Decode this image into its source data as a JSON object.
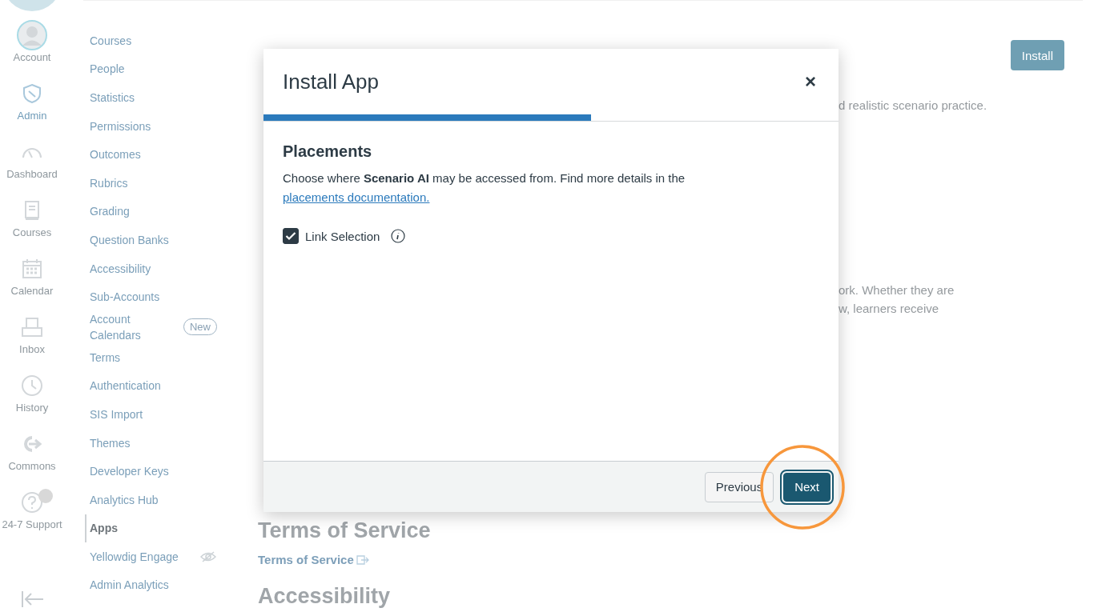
{
  "global_nav": [
    {
      "label": "Account",
      "selected": false,
      "unread": false
    },
    {
      "label": "Admin",
      "selected": true,
      "unread": false
    },
    {
      "label": "Dashboard",
      "selected": false,
      "unread": false
    },
    {
      "label": "Courses",
      "selected": false,
      "unread": false
    },
    {
      "label": "Calendar",
      "selected": false,
      "unread": false
    },
    {
      "label": "Inbox",
      "selected": false,
      "unread": false
    },
    {
      "label": "History",
      "selected": false,
      "unread": false
    },
    {
      "label": "Commons",
      "selected": false,
      "unread": false
    },
    {
      "label": "24-7 Support",
      "selected": false,
      "unread": true
    }
  ],
  "sub_nav": [
    {
      "label": "Courses",
      "selected": false,
      "hidden": false
    },
    {
      "label": "People",
      "selected": false,
      "hidden": false
    },
    {
      "label": "Statistics",
      "selected": false,
      "hidden": false
    },
    {
      "label": "Permissions",
      "selected": false,
      "hidden": false
    },
    {
      "label": "Outcomes",
      "selected": false,
      "hidden": false
    },
    {
      "label": "Rubrics",
      "selected": false,
      "hidden": false
    },
    {
      "label": "Grading",
      "selected": false,
      "hidden": false
    },
    {
      "label": "Question Banks",
      "selected": false,
      "hidden": false
    },
    {
      "label": "Accessibility",
      "selected": false,
      "hidden": false
    },
    {
      "label": "Sub-Accounts",
      "selected": false,
      "hidden": false
    },
    {
      "label": "Account Calendars",
      "selected": false,
      "hidden": false,
      "badge": "New"
    },
    {
      "label": "Terms",
      "selected": false,
      "hidden": false
    },
    {
      "label": "Authentication",
      "selected": false,
      "hidden": false
    },
    {
      "label": "SIS Import",
      "selected": false,
      "hidden": false
    },
    {
      "label": "Themes",
      "selected": false,
      "hidden": false
    },
    {
      "label": "Developer Keys",
      "selected": false,
      "hidden": false
    },
    {
      "label": "Analytics Hub",
      "selected": false,
      "hidden": false
    },
    {
      "label": "Apps",
      "selected": true,
      "hidden": false
    },
    {
      "label": "Yellowdig Engage",
      "selected": false,
      "hidden": true
    },
    {
      "label": "Admin Analytics",
      "selected": false,
      "hidden": false
    }
  ],
  "main": {
    "install_button": "Install",
    "fragments": [
      "d realistic scenario practice.",
      "ork. Whether they are",
      "w, learners receive"
    ],
    "terms_heading": "Terms of Service",
    "terms_link": "Terms of Service",
    "accessibility_heading": "Accessibility"
  },
  "modal": {
    "title": "Install App",
    "close": "×",
    "progress": {
      "level": 0.57
    },
    "heading": "Placements",
    "description": "Choose where **Scenario AI** may be accessed from. Find more details in the",
    "link": "placements documentation.",
    "placements": [
      {
        "label": "Link Selection",
        "checked": true
      }
    ],
    "buttons": [
      {
        "label": "Previous",
        "kind": "secondary"
      },
      {
        "label": "Next",
        "kind": "primary"
      }
    ]
  }
}
